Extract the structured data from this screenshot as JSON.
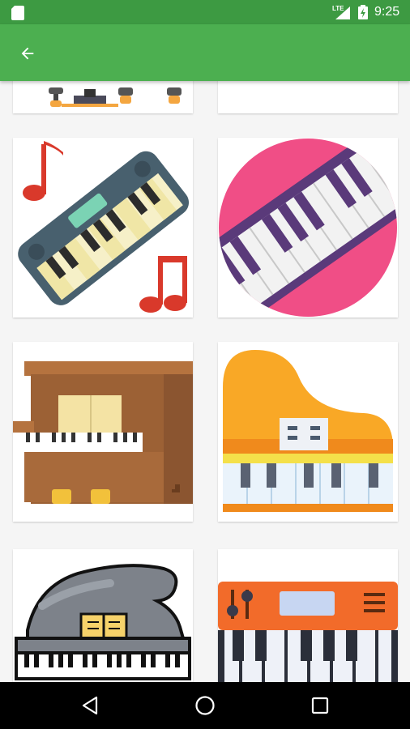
{
  "status_bar": {
    "network_label": "LTE",
    "time": "9:25",
    "icons": [
      "sd-card-icon",
      "signal-icon",
      "battery-icon"
    ]
  },
  "app_bar": {
    "back_icon": "arrow-back-icon",
    "color": "#4caf50"
  },
  "grid": {
    "items": [
      {
        "name": "piano-stand-partial"
      },
      {
        "name": "blank-partial"
      },
      {
        "name": "keyboard-with-music-notes"
      },
      {
        "name": "piano-keys-on-pink-circle"
      },
      {
        "name": "upright-piano"
      },
      {
        "name": "orange-grand-piano"
      },
      {
        "name": "gray-grand-piano-outlined"
      },
      {
        "name": "orange-synthesizer"
      }
    ]
  },
  "nav_bar": {
    "icons": [
      "back-triangle-icon",
      "home-circle-icon",
      "recents-square-icon"
    ]
  },
  "colors": {
    "status_bar": "#3d9a42",
    "app_bar": "#4caf50",
    "nav_bar": "#000000",
    "background": "#f5f5f5"
  }
}
